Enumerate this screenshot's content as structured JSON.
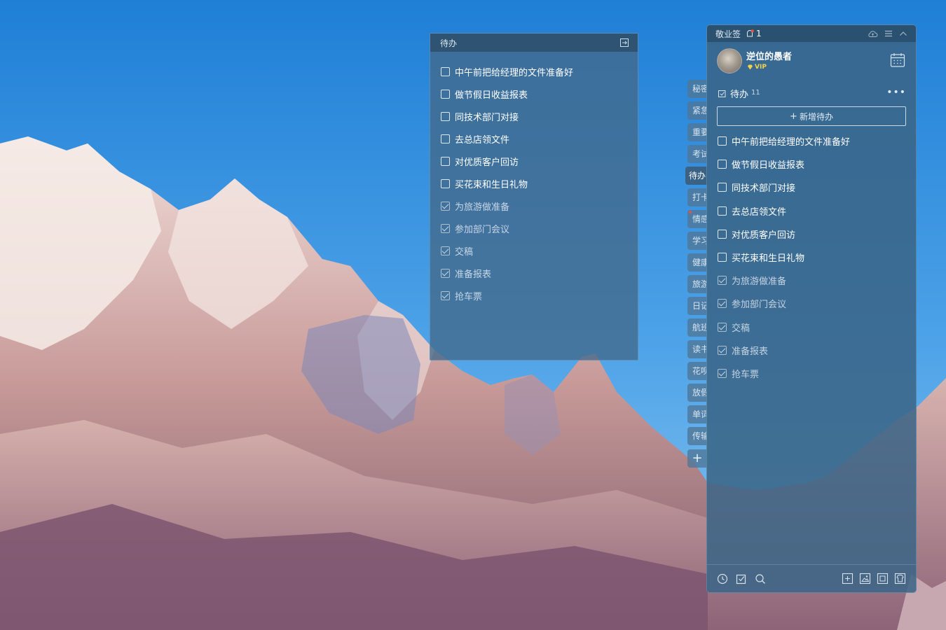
{
  "colors": {
    "panel_bg": "#3a6486",
    "titlebar_bg": "#284a66",
    "vip_gold": "#f3d24a",
    "notification_red": "#e8553e",
    "sky_top": "#1f7fd6",
    "mountain_snow": "#f4e9e4"
  },
  "note": {
    "title": "待办",
    "items": [
      {
        "label": "中午前把给经理的文件准备好",
        "done": false
      },
      {
        "label": "做节假日收益报表",
        "done": false
      },
      {
        "label": "同技术部门对接",
        "done": false
      },
      {
        "label": "去总店领文件",
        "done": false
      },
      {
        "label": "对优质客户回访",
        "done": false
      },
      {
        "label": "买花束和生日礼物",
        "done": false
      },
      {
        "label": "为旅游做准备",
        "done": true
      },
      {
        "label": "参加部门会议",
        "done": true
      },
      {
        "label": "交稿",
        "done": true
      },
      {
        "label": "准备报表",
        "done": true
      },
      {
        "label": "抢车票",
        "done": true
      }
    ]
  },
  "tabs": {
    "items": [
      {
        "label": "秘密"
      },
      {
        "label": "紧急"
      },
      {
        "label": "重要"
      },
      {
        "label": "考试"
      },
      {
        "label": "待办",
        "active": true
      },
      {
        "label": "打卡"
      },
      {
        "label": "情感",
        "dot": true
      },
      {
        "label": "学习"
      },
      {
        "label": "健康"
      },
      {
        "label": "旅游"
      },
      {
        "label": "日记"
      },
      {
        "label": "航班"
      },
      {
        "label": "读书"
      },
      {
        "label": "花呗"
      },
      {
        "label": "放假"
      },
      {
        "label": "单词"
      },
      {
        "label": "传输"
      }
    ],
    "add_label": "+"
  },
  "panel": {
    "app_name": "敬业签",
    "notification_count": "1",
    "icons": [
      "cloud-sync-icon",
      "menu-icon",
      "collapse-icon"
    ],
    "user": {
      "name": "逆位的愚者",
      "badge": "VIP"
    },
    "section": {
      "title": "待办",
      "count": "11",
      "more": "•••"
    },
    "add_button": "新增待办",
    "items": [
      {
        "label": "中午前把给经理的文件准备好",
        "done": false
      },
      {
        "label": "做节假日收益报表",
        "done": false
      },
      {
        "label": "同技术部门对接",
        "done": false
      },
      {
        "label": "去总店领文件",
        "done": false
      },
      {
        "label": "对优质客户回访",
        "done": false
      },
      {
        "label": "买花束和生日礼物",
        "done": false
      },
      {
        "label": "为旅游做准备",
        "done": true
      },
      {
        "label": "参加部门会议",
        "done": true
      },
      {
        "label": "交稿",
        "done": true
      },
      {
        "label": "准备报表",
        "done": true
      },
      {
        "label": "抢车票",
        "done": true
      }
    ],
    "footer_icons": [
      "clock-icon",
      "checkbox-icon",
      "search-icon",
      "add-note-icon",
      "image-icon",
      "window-icon",
      "shirt-icon"
    ]
  }
}
